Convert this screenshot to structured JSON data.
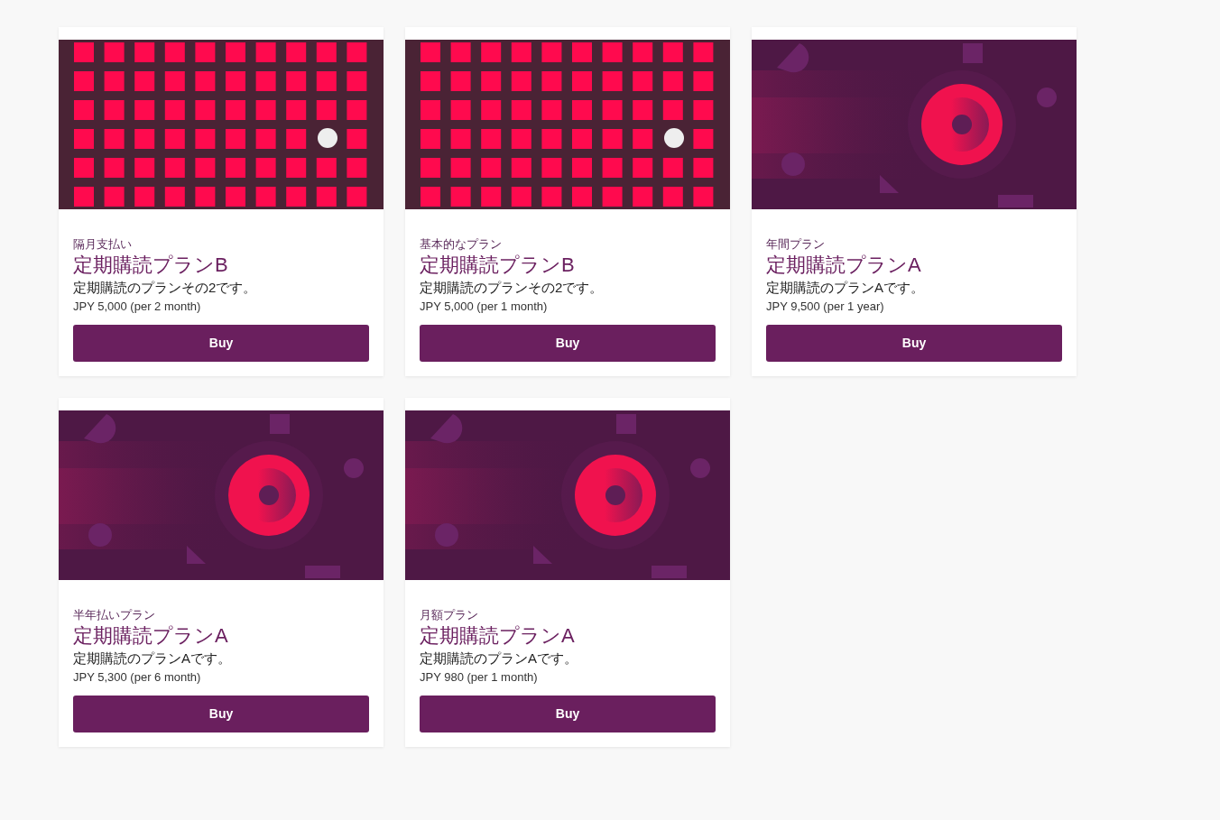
{
  "plans": [
    {
      "kind": "grid",
      "category": "隔月支払い",
      "title": "定期購読プランB",
      "description": "定期購読のプランその2です。",
      "price": "JPY 5,000 (per 2 month)",
      "button": "Buy"
    },
    {
      "kind": "grid",
      "category": "基本的なプラン",
      "title": "定期購読プランB",
      "description": "定期購読のプランその2です。",
      "price": "JPY 5,000 (per 1 month)",
      "button": "Buy"
    },
    {
      "kind": "disc",
      "category": "年間プラン",
      "title": "定期購読プランA",
      "description": "定期購読のプランAです。",
      "price": "JPY 9,500 (per 1 year)",
      "button": "Buy"
    },
    {
      "kind": "disc",
      "category": "半年払いプラン",
      "title": "定期購読プランA",
      "description": "定期購読のプランAです。",
      "price": "JPY 5,300 (per 6 month)",
      "button": "Buy"
    },
    {
      "kind": "disc",
      "category": "月額プラン",
      "title": "定期購読プランA",
      "description": "定期購読のプランAです。",
      "price": "JPY 980 (per 1 month)",
      "button": "Buy"
    }
  ]
}
